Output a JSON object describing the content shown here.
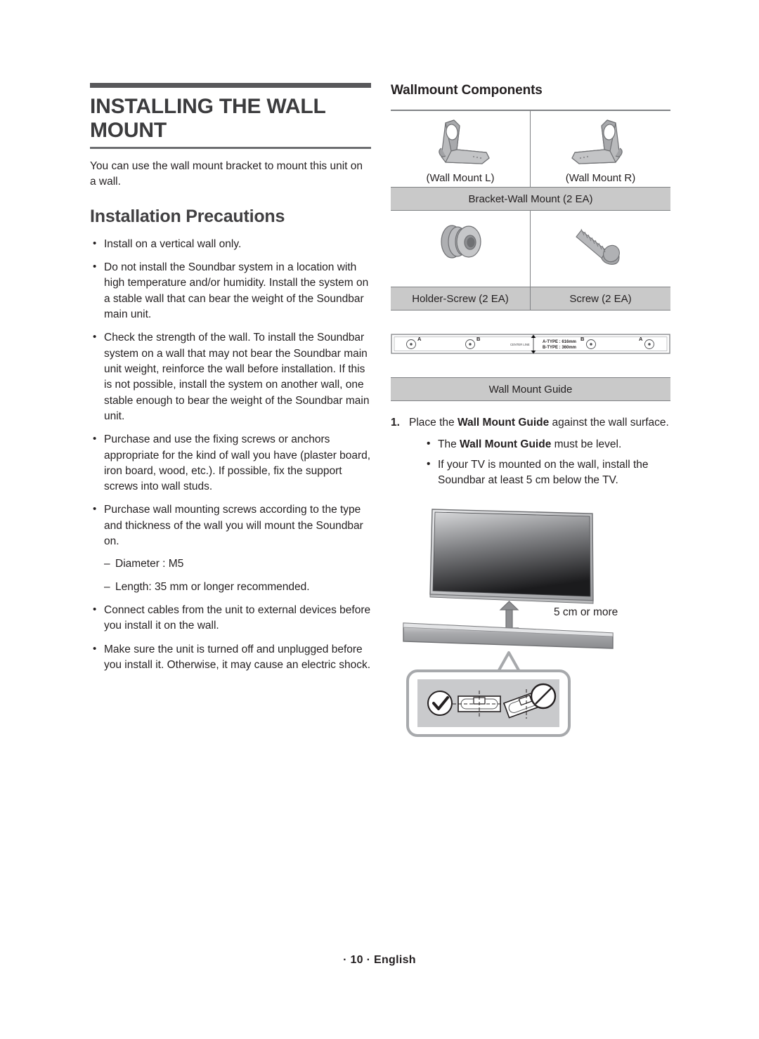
{
  "chapter": {
    "title": "INSTALLING THE WALL MOUNT",
    "intro": "You can use the wall mount bracket to mount this unit on a wall."
  },
  "precautions": {
    "heading": "Installation Precautions",
    "items": [
      "Install on a vertical wall only.",
      "Do not install the Soundbar system in a location with high temperature and/or humidity. Install the system on a stable wall that can bear the weight of the Soundbar main unit.",
      "Check the strength of the wall. To install the Soundbar system on a wall that may not bear the Soundbar main unit weight, reinforce the wall before installation. If this is not possible, install the system on another wall, one stable enough to bear the weight of the Soundbar main unit.",
      "Purchase and use the fixing screws or anchors appropriate for the kind of wall you have (plaster board, iron board, wood, etc.). If possible, fix the support screws into wall studs."
    ],
    "screws_item": "Purchase wall mounting screws according to the type and thickness of the wall you will mount the Soundbar on.",
    "screws_specs": [
      "Diameter : M5",
      "Length: 35 mm or longer recommended."
    ],
    "items_after": [
      "Connect cables from the unit to external devices before you install it on the wall.",
      "Make sure the unit is turned off and unplugged before you install it. Otherwise, it may cause an electric shock."
    ]
  },
  "wallmount": {
    "heading": "Wallmount Components",
    "bracket_left_caption": "(Wall Mount L)",
    "bracket_right_caption": "(Wall Mount R)",
    "bracket_label": "Bracket-Wall Mount (2 EA)",
    "holder_label": "Holder-Screw (2 EA)",
    "screw_label": "Screw (2 EA)",
    "guide_label": "Wall Mount Guide"
  },
  "guide_strip": {
    "hole_a_left": "A",
    "hole_b_left": "B",
    "center_line": "CENTER LINE",
    "a_type": "A-TYPE : 616mm",
    "b_type": "B-TYPE : 360mm",
    "hole_b_right": "B",
    "hole_a_right": "A"
  },
  "step1": {
    "number": "1.",
    "text_before": "Place the ",
    "text_bold": "Wall Mount Guide",
    "text_after": " against the wall surface.",
    "bullets": [
      {
        "before": "The ",
        "bold": "Wall Mount Guide",
        "after": " must be level."
      },
      {
        "before": "If your TV is mounted on the wall, install the Soundbar at least 5 cm below the TV.",
        "bold": "",
        "after": ""
      }
    ]
  },
  "figure": {
    "distance_label": "5 cm or more"
  },
  "footer": {
    "text": "· 10 · English"
  },
  "colors": {
    "rule_dark": "#58585b",
    "rule_light": "#6d6e71",
    "label_bar": "#c9c9c9",
    "border": "#808285",
    "text": "#231f20"
  }
}
